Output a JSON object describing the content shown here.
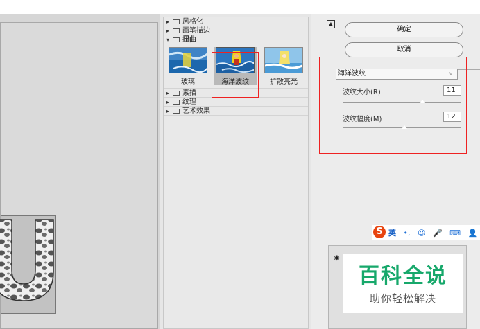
{
  "preview": {
    "letter": "U"
  },
  "gallery": {
    "categories": [
      {
        "label": "风格化",
        "expanded": false
      },
      {
        "label": "画笔描边",
        "expanded": false
      },
      {
        "label": "扭曲",
        "expanded": true
      },
      {
        "label": "素描",
        "expanded": false
      },
      {
        "label": "纹理",
        "expanded": false
      },
      {
        "label": "艺术效果",
        "expanded": false
      }
    ],
    "thumbnails": [
      {
        "label": "玻璃",
        "selected": false
      },
      {
        "label": "海洋波纹",
        "selected": true
      },
      {
        "label": "扩散亮光",
        "selected": false
      }
    ],
    "collapse_glyph": "▸",
    "expand_glyph": "▾"
  },
  "panel": {
    "ok_label": "确定",
    "cancel_label": "取消",
    "filter_select": "海洋波纹",
    "params": [
      {
        "label": "波纹大小(R)",
        "value": "11",
        "fraction": 0.67
      },
      {
        "label": "波纹幅度(M)",
        "value": "12",
        "fraction": 0.52
      }
    ]
  },
  "ime": {
    "logo": "S",
    "mode": "英",
    "items": [
      "•,",
      "☺",
      "🎤",
      "⌨",
      "👤",
      "👕"
    ]
  },
  "watermark": {
    "title": "百科全说",
    "subtitle": "助你轻松解决"
  },
  "colors": {
    "highlight_box": "#e22222",
    "watermark_green": "#17a86b",
    "sogou_orange": "#e8440f"
  }
}
